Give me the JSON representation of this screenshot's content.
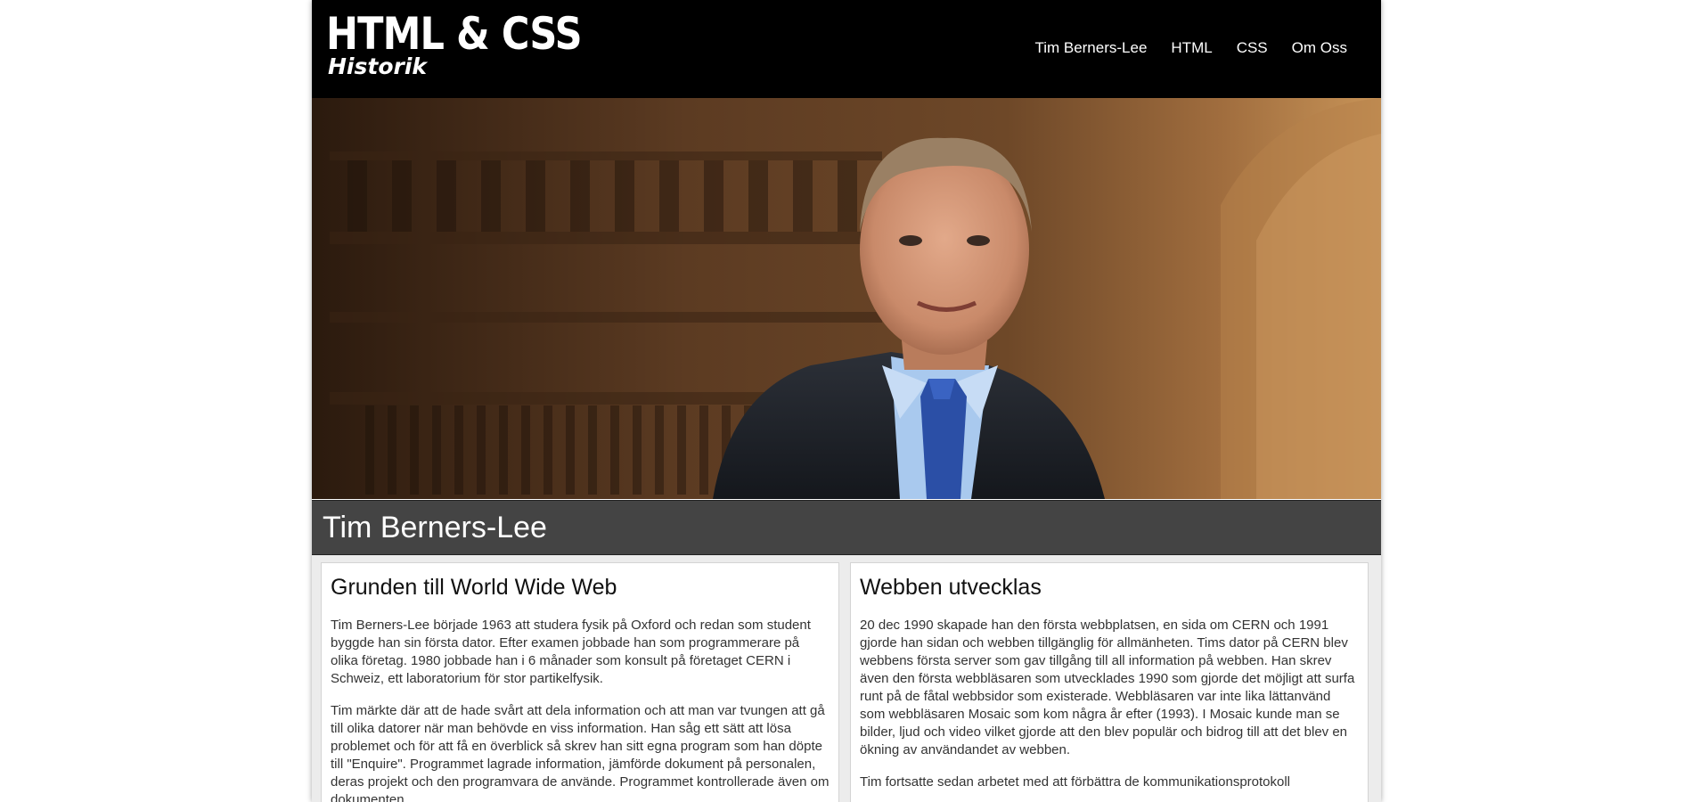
{
  "header": {
    "logo_title": "HTML & CSS",
    "logo_subtitle": "Historik",
    "nav": [
      {
        "label": "Tim Berners-Lee"
      },
      {
        "label": "HTML"
      },
      {
        "label": "CSS"
      },
      {
        "label": "Om Oss"
      }
    ]
  },
  "hero": {
    "icon": "portrait-photo"
  },
  "section": {
    "title": "Tim Berners-Lee"
  },
  "cards": [
    {
      "heading": "Grunden till World Wide Web",
      "paragraphs": [
        "Tim Berners-Lee började 1963 att studera fysik på Oxford och redan som student byggde han sin första dator. Efter examen jobbade han som programmerare på olika företag. 1980 jobbade han i 6 månader som konsult på företaget CERN i Schweiz, ett laboratorium för stor partikelfysik.",
        "Tim märkte där att de hade svårt att dela information och att man var tvungen att gå till olika datorer när man behövde en viss information. Han såg ett sätt att lösa problemet och för att få en överblick så skrev han sitt egna program som han döpte till \"Enquire\". Programmet lagrade information, jämförde dokument på personalen, deras projekt och den programvara de använde. Programmet kontrollerade även om dokumenten"
      ]
    },
    {
      "heading": "Webben utvecklas",
      "paragraphs": [
        "20 dec 1990 skapade han den första webbplatsen, en sida om CERN och 1991 gjorde han sidan och webben tillgänglig för allmänheten. Tims dator på CERN blev webbens första server som gav tillgång till all information på webben. Han skrev även den första webbläsaren som utvecklades 1990 som gjorde det möjligt att surfa runt på de fåtal webbsidor som existerade. Webbläsaren var inte lika lättanvänd som webbläsaren Mosaic som kom några år efter (1993). I Mosaic kunde man se bilder, ljud och video vilket gjorde att den blev populär och bidrog till att det blev en ökning av användandet av webben.",
        "Tim fortsatte sedan arbetet med att förbättra de kommunikationsprotokoll"
      ]
    }
  ],
  "colors": {
    "header_bg": "#000000",
    "section_bar_bg": "#444444",
    "content_bg": "#ececec",
    "card_bg": "#ffffff"
  }
}
